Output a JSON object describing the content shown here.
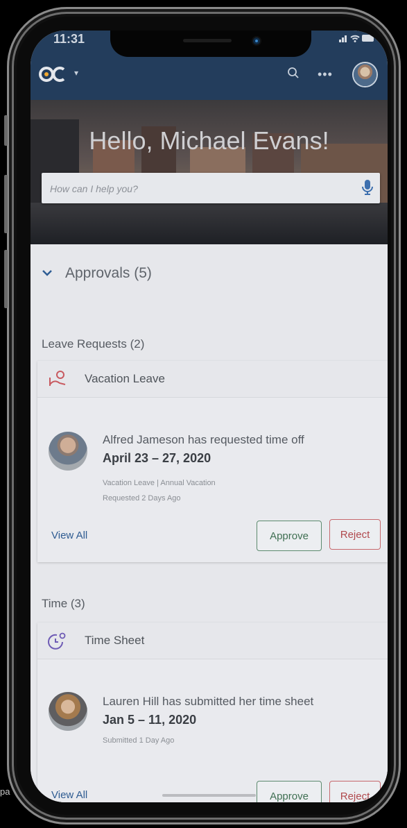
{
  "status_bar": {
    "time": "11:31",
    "icons": "signal-wifi-battery"
  },
  "app_header": {
    "logo_text": "ac",
    "logo_caret": "▾",
    "search_icon": "search-icon",
    "more_icon": "•••",
    "avatar_icon": "avatar"
  },
  "hero": {
    "greeting": "Hello, Michael Evans!",
    "search_placeholder": "How can I help you?"
  },
  "approvals": {
    "label": "Approvals (5)",
    "expanded": true,
    "leave_section": {
      "title": "Leave Requests (2)",
      "card_title": "Vacation Leave",
      "request_text": "Alfred Jameson has requested time off",
      "request_dates": "April 23 – 27, 2020",
      "meta_line1": "Vacation Leave | Annual Vacation",
      "meta_line2": "Requested 2 Days Ago",
      "view_all": "View All",
      "approve": "Approve",
      "reject": "Reject"
    },
    "time_section": {
      "title": "Time (3)",
      "card_title": "Time Sheet",
      "request_text": "Lauren Hill has submitted her time sheet",
      "request_dates": "Jan 5 – 11, 2020",
      "meta_line1": "Submitted 1 Day Ago",
      "view_all": "View All",
      "approve": "Approve",
      "reject": "Reject"
    }
  },
  "colors": {
    "header_bg": "#233d5c",
    "approve": "#3f6f52",
    "reject": "#b0494d",
    "link": "#2e5b91"
  },
  "edge_label": "pa"
}
